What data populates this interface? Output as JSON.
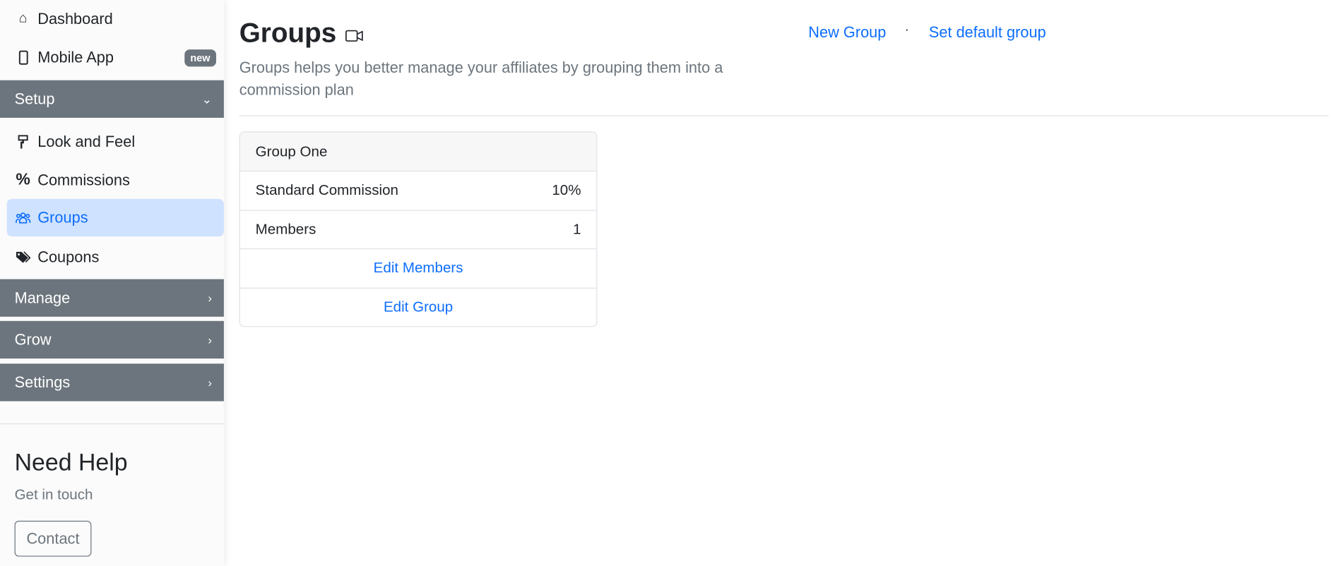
{
  "sidebar": {
    "top_items": [
      {
        "label": "Dashboard",
        "icon": "house-icon"
      },
      {
        "label": "Mobile App",
        "icon": "phone-icon",
        "badge": "new"
      }
    ],
    "sections": [
      {
        "label": "Setup",
        "expanded": true,
        "items": [
          {
            "label": "Look and Feel",
            "icon": "paint-roller-icon"
          },
          {
            "label": "Commissions",
            "icon": "percent-icon"
          },
          {
            "label": "Groups",
            "icon": "people-icon",
            "active": true
          },
          {
            "label": "Coupons",
            "icon": "tags-icon"
          }
        ]
      },
      {
        "label": "Manage",
        "expanded": false
      },
      {
        "label": "Grow",
        "expanded": false
      },
      {
        "label": "Settings",
        "expanded": false
      }
    ],
    "help": {
      "title": "Need Help",
      "subtitle": "Get in touch",
      "button": "Contact"
    }
  },
  "main": {
    "title": "Groups",
    "description": "Groups helps you better manage your affiliates by grouping them into a commission plan",
    "actions": {
      "new_group": "New Group",
      "separator": "·",
      "set_default": "Set default group"
    },
    "group_card": {
      "name": "Group One",
      "rows": [
        {
          "label": "Standard Commission",
          "value": "10%"
        },
        {
          "label": "Members",
          "value": "1"
        }
      ],
      "edit_members": "Edit Members",
      "edit_group": "Edit Group"
    }
  },
  "colors": {
    "accent": "#0d6efd",
    "section_bg": "#6c757d",
    "active_bg": "#cfe2ff"
  }
}
